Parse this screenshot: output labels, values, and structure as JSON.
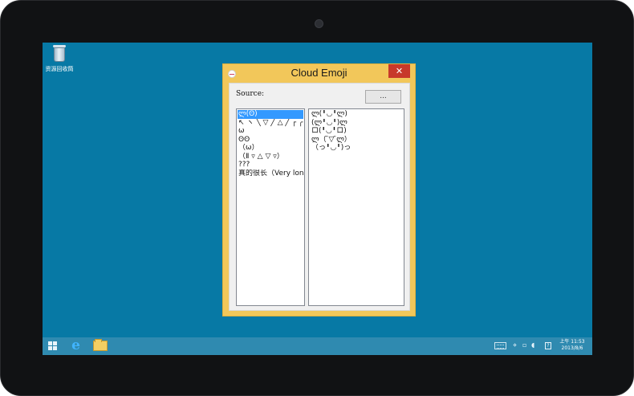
{
  "desktop": {
    "recycle_bin_label": "资源回收筒"
  },
  "window": {
    "title": "Cloud Emoji",
    "close_glyph": "✕",
    "source_label": "Source:",
    "browse_label": "...",
    "categories": [
      "ლ(ʘ̆)",
      "↖ ヽ ╲ ▽ ╱ △ ╱ ┌ ╭ ╱",
      "ω",
      "ʘʘ",
      "（ω）",
      "（Ⅱ ▿ △ ▽ ▿）",
      "???",
      "真的很长（Very long"
    ],
    "selected_category_index": 0,
    "emojis": [
      "ლ(╹◡╹ლ)",
      "(ლ╹◡╹)ლ",
      "ロ(╹◡╹ロ)",
      "ლ（ ̄▽ ̄ლ）",
      "（っ╹◡╹)っ"
    ]
  },
  "taskbar": {
    "start_icon": "windows-logo-icon",
    "ie_glyph": "e",
    "tray_glyphs": [
      "⋄",
      "▫",
      "◖"
    ],
    "tray_box_glyph": "?",
    "clock_time": "上午 11:53",
    "clock_date": "2013/8/6"
  },
  "colors": {
    "desktop": "#0779a5",
    "window_frame": "#f2c75a",
    "close_button": "#c7392b",
    "selection": "#3399ff",
    "taskbar": "#2f8ab0"
  }
}
